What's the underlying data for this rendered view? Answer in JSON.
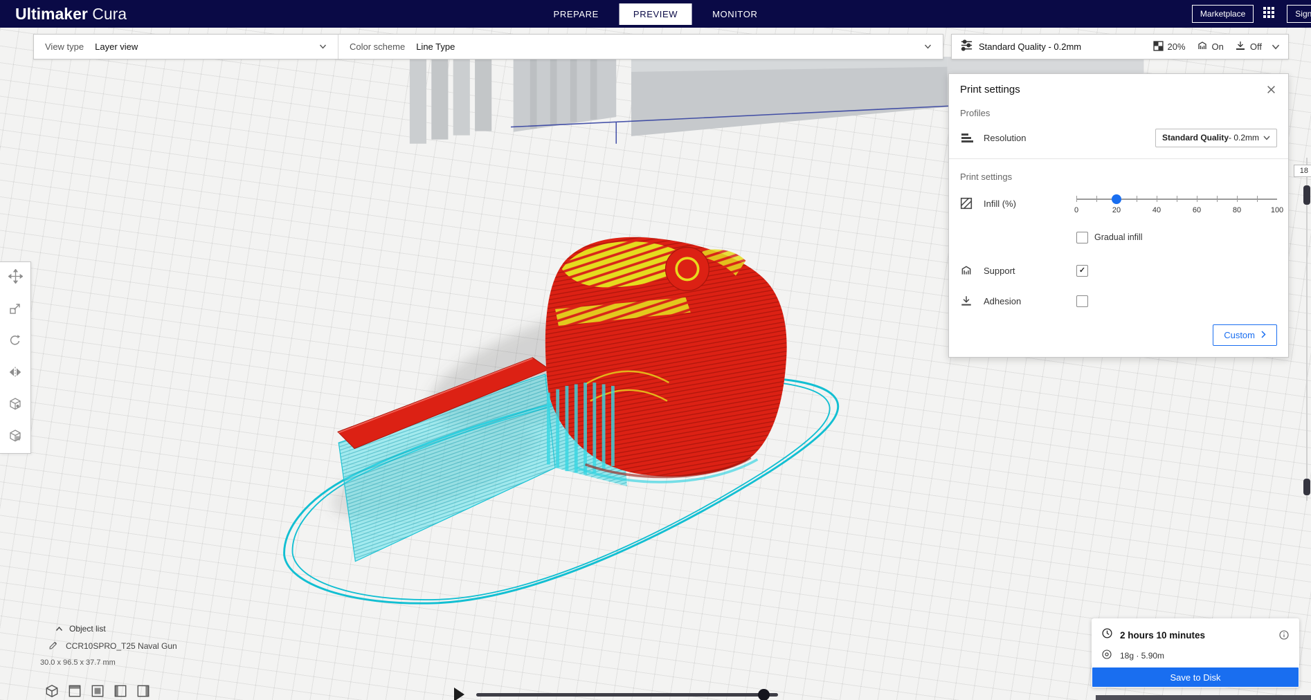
{
  "colors": {
    "header_bg": "#0a0a46",
    "accent": "#196ef0",
    "model_red": "#dc2114",
    "infill_yellow": "#e5db1f",
    "support_cyan": "#38d8e4"
  },
  "app": {
    "brand_bold": "Ultimaker",
    "brand_light": " Cura",
    "tabs": [
      {
        "label": "PREPARE"
      },
      {
        "label": "PREVIEW"
      },
      {
        "label": "MONITOR"
      }
    ],
    "active_tab": "PREVIEW",
    "marketplace_label": "Marketplace",
    "sign_in_label": "Sign in"
  },
  "view_bar": {
    "view_type_label": "View type",
    "view_type_value": "Layer view",
    "color_scheme_label": "Color scheme",
    "color_scheme_value": "Line Type"
  },
  "summary_bar": {
    "profile": "Standard Quality - 0.2mm",
    "infill": "20%",
    "support": "On",
    "adhesion": "Off"
  },
  "print_settings": {
    "title": "Print settings",
    "profiles_heading": "Profiles",
    "resolution_label": "Resolution",
    "resolution_value_bold": "Standard Quality",
    "resolution_value_suffix": " - 0.2mm",
    "section_heading": "Print settings",
    "infill_label": "Infill (%)",
    "infill_percent": 20,
    "infill_ticks": [
      "0",
      "20",
      "40",
      "60",
      "80",
      "100"
    ],
    "gradual_label": "Gradual infill",
    "gradual_check": "",
    "support_label": "Support",
    "support_check": "✓",
    "adhesion_label": "Adhesion",
    "adhesion_check": "",
    "custom_label": "Custom"
  },
  "left_toolbar": {
    "tools": [
      "Move",
      "Scale",
      "Rotate",
      "Mirror",
      "Per Model Settings",
      "Support Blocker"
    ]
  },
  "object_list": {
    "toggle_label": "Object list",
    "item_name": "CCR10SPRO_T25 Naval Gun",
    "dimensions": "30.0 x 96.5 x 37.7 mm"
  },
  "simulation": {
    "current_layer": "18"
  },
  "output": {
    "time": "2 hours 10 minutes",
    "material": "18g · 5.90m",
    "save_label": "Save to Disk"
  }
}
